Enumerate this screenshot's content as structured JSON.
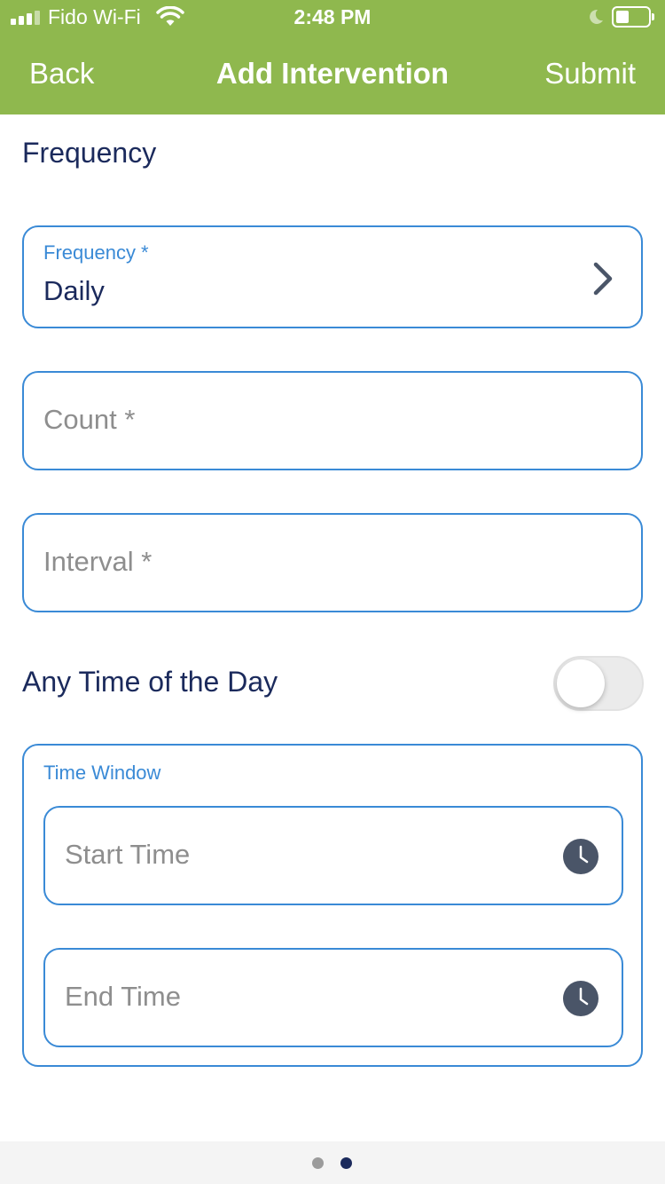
{
  "status_bar": {
    "carrier": "Fido Wi-Fi",
    "time": "2:48 PM",
    "icons": [
      "signal-icon",
      "wifi-icon",
      "moon-icon",
      "battery-icon"
    ]
  },
  "nav": {
    "back_label": "Back",
    "title": "Add Intervention",
    "submit_label": "Submit"
  },
  "section": {
    "title": "Frequency"
  },
  "form": {
    "frequency": {
      "label": "Frequency *",
      "value": "Daily"
    },
    "count": {
      "placeholder": "Count *"
    },
    "interval": {
      "placeholder": "Interval *"
    },
    "any_time": {
      "label": "Any Time of the Day",
      "enabled": false
    },
    "time_window": {
      "label": "Time Window",
      "start_placeholder": "Start Time",
      "end_placeholder": "End Time"
    }
  },
  "pager": {
    "page_count": 2,
    "current_page": 2
  },
  "colors": {
    "header": "#8fb84e",
    "accent": "#3a8ad6",
    "text_dark": "#1b2a5c",
    "placeholder": "#8e8e8e"
  }
}
